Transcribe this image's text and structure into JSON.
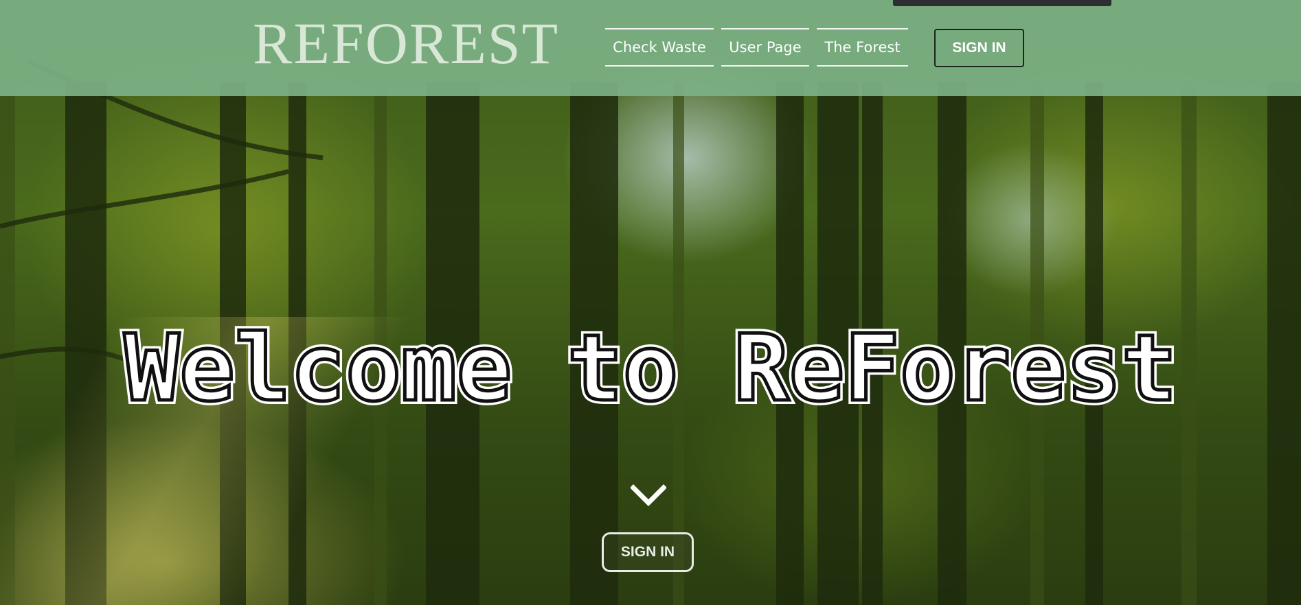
{
  "header": {
    "logo": "REFOREST",
    "nav": [
      {
        "label": "Check Waste"
      },
      {
        "label": "User Page"
      },
      {
        "label": "The Forest"
      }
    ],
    "signin_label": "SIGN IN"
  },
  "hero": {
    "title": "Welcome to ReForest",
    "scroll_icon": "chevron-down-icon",
    "signin_label": "SIGN IN"
  },
  "colors": {
    "header_bg": "#7cb084",
    "text": "#ffffff",
    "logo_text": "#d9e8d6",
    "signin_border": "#1d261c"
  }
}
